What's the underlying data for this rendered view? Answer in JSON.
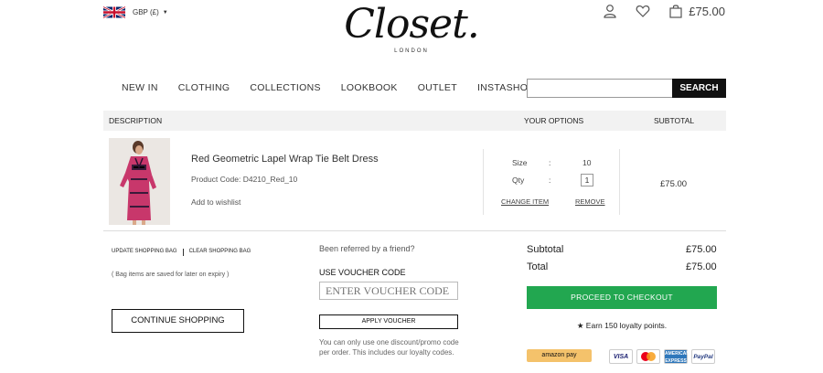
{
  "header": {
    "currency": "GBP (£)",
    "logo_mark": "Closet.",
    "logo_sub": "LONDON",
    "bag_total": "£75.00"
  },
  "nav": {
    "items": [
      "NEW IN",
      "CLOTHING",
      "COLLECTIONS",
      "LOOKBOOK",
      "OUTLET",
      "INSTASHOP"
    ]
  },
  "search": {
    "value": "",
    "button": "SEARCH"
  },
  "table": {
    "col_description": "DESCRIPTION",
    "col_options": "YOUR OPTIONS",
    "col_subtotal": "SUBTOTAL"
  },
  "item": {
    "name": "Red Geometric Lapel Wrap Tie Belt Dress",
    "code": "Product Code: D4210_Red_10",
    "wishlist": "Add to wishlist",
    "size_label": "Size",
    "size_value": "10",
    "qty_label": "Qty",
    "qty_value": "1",
    "colon": ":",
    "change": "CHANGE ITEM",
    "remove": "REMOVE",
    "subtotal": "£75.00"
  },
  "bag_actions": {
    "update": "UPDATE SHOPPING BAG",
    "clear": "CLEAR SHOPPING BAG",
    "saved_note": "( Bag items are saved for later on expiry )",
    "continue": "CONTINUE SHOPPING"
  },
  "voucher": {
    "referred": "Been referred by a friend?",
    "label": "USE VOUCHER CODE",
    "placeholder": "ENTER VOUCHER CODE",
    "apply": "APPLY VOUCHER",
    "note": "You can only use one discount/promo code per order. This includes our loyalty codes."
  },
  "totals": {
    "subtotal_label": "Subtotal",
    "subtotal_value": "£75.00",
    "total_label": "Total",
    "total_value": "£75.00",
    "checkout": "PROCEED TO CHECKOUT",
    "loyalty": "★ Earn 150 loyalty points."
  },
  "payments": {
    "amazon": "amazon pay",
    "visa": "VISA",
    "amex": "AMERICAN EXPRESS",
    "paypal": "PayPal"
  },
  "colors": {
    "checkout_green": "#22a750",
    "search_button": "#111111",
    "table_header_bg": "#f2f2f2"
  }
}
